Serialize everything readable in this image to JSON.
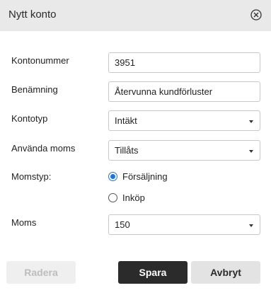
{
  "dialog": {
    "title": "Nytt konto",
    "close_icon": "close-circle-icon"
  },
  "form": {
    "account_number": {
      "label": "Kontonummer",
      "value": "3951"
    },
    "name": {
      "label": "Benämning",
      "value": "Återvunna kundförluster"
    },
    "account_type": {
      "label": "Kontotyp",
      "value": "Intäkt"
    },
    "use_vat": {
      "label": "Använda moms",
      "value": "Tillåts"
    },
    "vat_type": {
      "label": "Momstyp:",
      "options": [
        {
          "label": "Försäljning",
          "checked": true
        },
        {
          "label": "Inköp",
          "checked": false
        }
      ]
    },
    "vat": {
      "label": "Moms",
      "value": "150"
    }
  },
  "buttons": {
    "delete": "Radera",
    "save": "Spara",
    "cancel": "Avbryt"
  },
  "colors": {
    "header_bg": "#e9e9e9",
    "radio_accent": "#1a73e8",
    "save_bg": "#2b2b2b",
    "cancel_bg": "#e3e3e3",
    "delete_bg": "#efefef"
  }
}
